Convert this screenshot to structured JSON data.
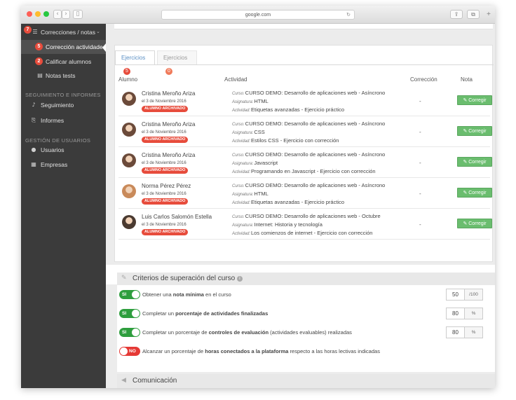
{
  "browser": {
    "url": "google.com",
    "dots": [
      "#fe5f57",
      "#febc2e",
      "#28c840"
    ]
  },
  "sidebar": {
    "top_item": {
      "label": "Correcciones / notas",
      "badge": "7"
    },
    "sub_items": [
      {
        "label": "Corrección actividades",
        "badge": "5",
        "active": true
      },
      {
        "label": "Calificar alumnos",
        "badge": "2",
        "active": false
      },
      {
        "label": "Notas tests",
        "badge": "",
        "active": false
      }
    ],
    "section1": {
      "heading": "SEGUIMIENTO E INFORMES",
      "items": [
        "Seguimiento",
        "Informes"
      ]
    },
    "section2": {
      "heading": "GESTIÓN DE USUARIOS",
      "items": [
        "Usuarios",
        "Empresas"
      ]
    }
  },
  "tabs": [
    {
      "label": "Ejercicios",
      "badge": "5",
      "active": true
    },
    {
      "label": "Ejercicios",
      "badge": "0",
      "active": false
    }
  ],
  "table": {
    "headers": {
      "alumno": "Alumno",
      "actividad": "Actividad",
      "correccion": "Corrección",
      "nota": "Nota"
    },
    "labels": {
      "curso": "Curso:",
      "asignatura": "Asignatura:",
      "actividad": "Actividad:"
    },
    "button_label": "Corregir",
    "rows": [
      {
        "name": "Cristina Meroño Ariza",
        "date": "el 3 de Noviembre 2016",
        "badge": "ALUMNO ARCHIVADO",
        "curso": "CURSO DEMO: Desarrollo de aplicaciones web - Asíncrono",
        "asignatura": "HTML",
        "actividad": "Etiquetas avanzadas - Ejercicio práctico",
        "correccion": "-"
      },
      {
        "name": "Cristina Meroño Ariza",
        "date": "el 3 de Noviembre 2016",
        "badge": "ALUMNO ARCHIVADO",
        "curso": "CURSO DEMO: Desarrollo de aplicaciones web - Asíncrono",
        "asignatura": "CSS",
        "actividad": "Estilos CSS - Ejercicio con corrección",
        "correccion": "-"
      },
      {
        "name": "Cristina Meroño Ariza",
        "date": "el 3 de Noviembre 2016",
        "badge": "ALUMNO ARCHIVADO",
        "curso": "CURSO DEMO: Desarrollo de aplicaciones web - Asíncrono",
        "asignatura": "Javascript",
        "actividad": "Programando en Javascript - Ejercicio con corrección",
        "correccion": "-"
      },
      {
        "name": "Norma Pérez Pérez",
        "date": "el 3 de Noviembre 2016",
        "badge": "ALUMNO ARCHIVADO",
        "curso": "CURSO DEMO: Desarrollo de aplicaciones web - Asíncrono",
        "asignatura": "HTML",
        "actividad": "Etiquetas avanzadas - Ejercicio práctico",
        "correccion": "-"
      },
      {
        "name": "Luis Carlos Salomón Estella",
        "date": "el 3 de Noviembre 2016",
        "badge": "ALUMNO ARCHIVADO",
        "curso": "CURSO DEMO: Desarrollo de aplicaciones web - Octubre",
        "asignatura": "Internet: Historia y tecnología",
        "actividad": "Los comienzos de internet - Ejercicio con corrección",
        "correccion": "-"
      }
    ]
  },
  "criteria": {
    "title": "Criterios de superación del curso",
    "items": [
      {
        "state": "SI",
        "on": true,
        "pre": "Obtener una ",
        "bold": "nota mínima",
        "post": " en el curso",
        "pre2": "",
        "bold2": "",
        "post2": "",
        "value": "50",
        "unit": "/100"
      },
      {
        "state": "SI",
        "on": true,
        "pre": "Completar un ",
        "bold": "porcentaje de actividades finalizadas",
        "post": "",
        "pre2": "",
        "bold2": "",
        "post2": "",
        "value": "80",
        "unit": "%"
      },
      {
        "state": "SI",
        "on": true,
        "pre": "Completar un porcentaje de ",
        "bold": "controles de evaluación",
        "post": " (actividades evaluables) realizadas",
        "pre2": "",
        "bold2": "",
        "post2": "",
        "value": "80",
        "unit": "%"
      },
      {
        "state": "NO",
        "on": false,
        "pre": "Alcanzar un porcentaje de ",
        "bold": "horas conectados a la plataforma",
        "post": " respecto a las horas lectivas indicadas",
        "pre2": "",
        "bold2": "",
        "post2": "",
        "value": "",
        "unit": ""
      }
    ]
  },
  "communication": {
    "title": "Comunicación"
  },
  "colors": {
    "accent_green": "#6abd6e",
    "badge_red": "#e74c3c",
    "tab_blue": "#5a8fc4",
    "toggle_on": "#2e9e3e",
    "toggle_off": "#e53935"
  }
}
